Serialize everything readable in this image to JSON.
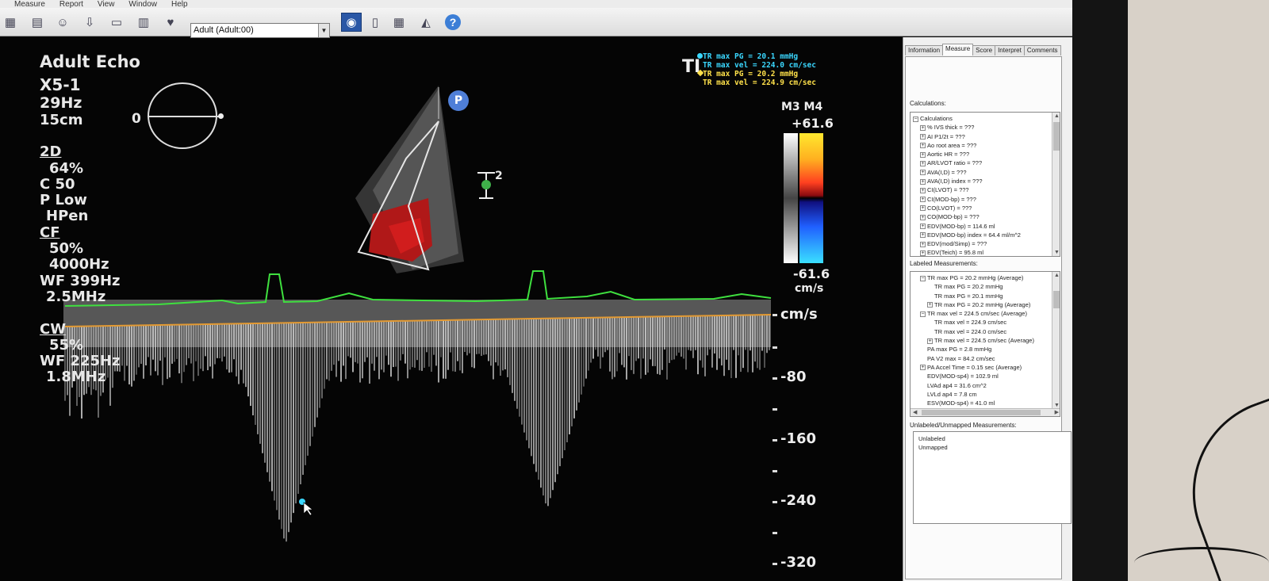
{
  "menu": [
    "Measure",
    "Report",
    "View",
    "Window",
    "Help"
  ],
  "toolbar": {
    "preset_value": "Adult (Adult:00)",
    "icons": [
      "patient-icon",
      "report-icon",
      "user-icon",
      "export-icon",
      "film-icon",
      "print-icon",
      "heart-icon",
      "document-icon",
      "table-icon",
      "probe-icon",
      "help-icon"
    ],
    "help_glyph": "?"
  },
  "overlay": {
    "exam": "Adult Echo",
    "probe": "X5-1",
    "frame_rate": "29Hz",
    "depth": "15cm",
    "angle": "0",
    "mode_2d": "2D",
    "gain_2d": "64%",
    "compress": "C 50",
    "power": "P Low",
    "harmonic": "HPen",
    "mode_cf": "CF",
    "gain_cf": "50%",
    "prf_cf": "4000Hz",
    "wf_cf": "WF 399Hz",
    "freq_cf": "2.5MHz",
    "mode_cw": "CW",
    "gain_cw": "55%",
    "wf_cw": "WF 225Hz",
    "freq_cw": "1.8MHz",
    "p_marker": "P",
    "sample_marker": "2"
  },
  "tr_readouts": [
    {
      "text": "TR max PG = 20.1 mmHg",
      "color": "#3ad7ff"
    },
    {
      "text": "TR max vel = 224.0 cm/sec",
      "color": "#3ad7ff"
    },
    {
      "text": "TR max PG = 20.2 mmHg",
      "color": "#ffe14a"
    },
    {
      "text": "TR max vel = 224.9 cm/sec",
      "color": "#ffe14a"
    }
  ],
  "ti_label": "TI",
  "color_bar": {
    "mode": "M3 M4",
    "top": "+61.6",
    "bottom": "-61.6",
    "unit": "cm/s"
  },
  "scale": {
    "unit": "cm/s",
    "labels": [
      "-80",
      "-160",
      "-240",
      "-320"
    ]
  },
  "panel": {
    "tabs": [
      "Information",
      "Measure",
      "Score",
      "Interpret",
      "Comments"
    ],
    "active_tab": "Measure",
    "calc_label": "Calculations:",
    "calc_items": [
      {
        "text": "Calculations",
        "sign": "−",
        "indent": 0
      },
      {
        "text": "% IVS thick = ???",
        "sign": "+",
        "indent": 1
      },
      {
        "text": "AI P1/2t = ???",
        "sign": "+",
        "indent": 1
      },
      {
        "text": "Ao root area = ???",
        "sign": "+",
        "indent": 1
      },
      {
        "text": "Aortic HR = ???",
        "sign": "+",
        "indent": 1
      },
      {
        "text": "AR/LVOT ratio = ???",
        "sign": "+",
        "indent": 1
      },
      {
        "text": "AVA(I,D) = ???",
        "sign": "+",
        "indent": 1
      },
      {
        "text": "AVA(I,D) index = ???",
        "sign": "+",
        "indent": 1
      },
      {
        "text": "CI(LVOT) = ???",
        "sign": "+",
        "indent": 1
      },
      {
        "text": "CI(MOD-bp) = ???",
        "sign": "+",
        "indent": 1
      },
      {
        "text": "CO(LVOT) = ???",
        "sign": "+",
        "indent": 1
      },
      {
        "text": "CO(MOD-bp) = ???",
        "sign": "+",
        "indent": 1
      },
      {
        "text": "EDV(MOD-bp) = 114.6 ml",
        "sign": "+",
        "indent": 1
      },
      {
        "text": "EDV(MOD-bp) index = 64.4 ml/m^2",
        "sign": "+",
        "indent": 1
      },
      {
        "text": "EDV(mod/Simp) = ???",
        "sign": "+",
        "indent": 1
      },
      {
        "text": "EDV(Teich) = 95.8 ml",
        "sign": "+",
        "indent": 1
      }
    ],
    "labeled_label": "Labeled Measurements:",
    "labeled_items": [
      {
        "text": "TR max PG = 20.2 mmHg (Average)",
        "sign": "−",
        "indent": 1
      },
      {
        "text": "TR max PG = 20.2 mmHg",
        "sign": "",
        "indent": 3
      },
      {
        "text": "TR max PG = 20.1 mmHg",
        "sign": "",
        "indent": 3
      },
      {
        "text": "TR max PG = 20.2 mmHg (Average)",
        "sign": "+",
        "indent": 2
      },
      {
        "text": "TR max vel = 224.5 cm/sec (Average)",
        "sign": "−",
        "indent": 1
      },
      {
        "text": "TR max vel = 224.9 cm/sec",
        "sign": "",
        "indent": 3
      },
      {
        "text": "TR max vel = 224.0 cm/sec",
        "sign": "",
        "indent": 3
      },
      {
        "text": "TR max vel = 224.5 cm/sec (Average)",
        "sign": "+",
        "indent": 2
      },
      {
        "text": "PA max PG = 2.8 mmHg",
        "sign": "",
        "indent": 2
      },
      {
        "text": "PA V2 max = 84.2 cm/sec",
        "sign": "",
        "indent": 2
      },
      {
        "text": "PA Accel Time = 0.15 sec (Average)",
        "sign": "+",
        "indent": 1
      },
      {
        "text": "EDV(MOD-sp4) = 102.9 ml",
        "sign": "",
        "indent": 2
      },
      {
        "text": "LVAd ap4 = 31.6 cm^2",
        "sign": "",
        "indent": 2
      },
      {
        "text": "LVLd ap4 = 7.8 cm",
        "sign": "",
        "indent": 2
      },
      {
        "text": "ESV(MOD-sp4) = 41.0 ml",
        "sign": "",
        "indent": 2
      }
    ],
    "unlabeled_label": "Unlabeled/Unmapped Measurements:",
    "unlabeled_items": [
      "Unlabeled",
      "Unmapped"
    ]
  }
}
